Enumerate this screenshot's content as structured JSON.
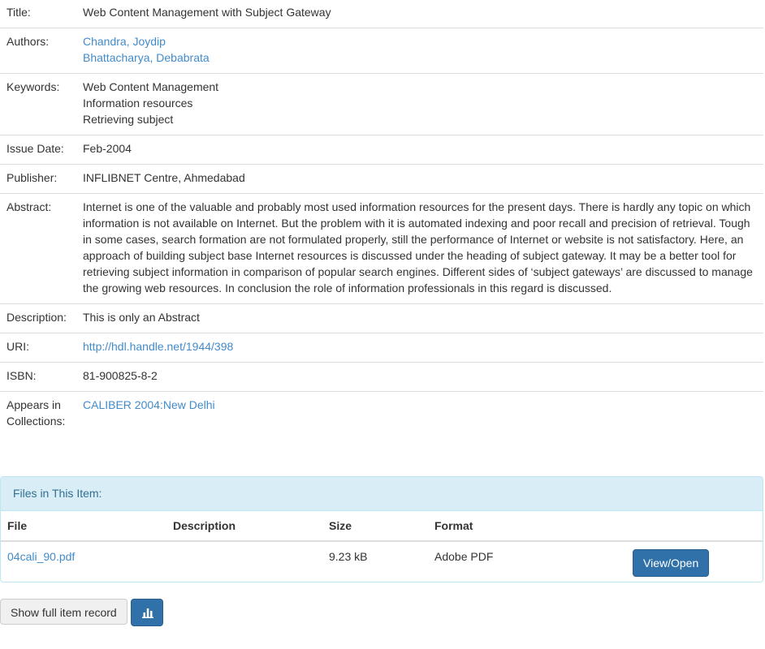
{
  "metadata": {
    "title": {
      "label": "Title:",
      "value": "Web Content Management with Subject Gateway"
    },
    "authors": {
      "label": "Authors:",
      "values": [
        "Chandra, Joydip",
        "Bhattacharya, Debabrata"
      ]
    },
    "keywords": {
      "label": "Keywords:",
      "values": [
        "Web Content Management",
        "Information resources",
        "Retrieving subject"
      ]
    },
    "issue_date": {
      "label": "Issue Date:",
      "value": "Feb-2004"
    },
    "publisher": {
      "label": "Publisher:",
      "value": "INFLIBNET Centre, Ahmedabad"
    },
    "abstract": {
      "label": "Abstract:",
      "value": "Internet is one of the valuable and probably most used information resources for the present days. There is hardly any topic on which information is not available on Internet. But the problem with it is automated indexing and poor recall and precision of retrieval. Tough in some cases, search formation are not formulated properly, still the performance of Internet or website is not satisfactory. Here, an approach of building subject base Internet resources is discussed under the heading of subject gateway. It may be a better tool for retrieving subject information in comparison of popular search engines. Different sides of ‘subject gateways’ are discussed to manage the growing web resources. In conclusion the role of information professionals in this regard is discussed."
    },
    "description": {
      "label": "Description:",
      "value": "This is only an Abstract"
    },
    "uri": {
      "label": "URI:",
      "value": "http://hdl.handle.net/1944/398"
    },
    "isbn": {
      "label": "ISBN:",
      "value": "81-900825-8-2"
    },
    "collections": {
      "label_line1": "Appears in",
      "label_line2": "Collections:",
      "value": "CALIBER 2004:New Delhi"
    }
  },
  "files_panel": {
    "heading": "Files in This Item:",
    "columns": [
      "File",
      "Description",
      "Size",
      "Format"
    ],
    "rows": [
      {
        "file": "04cali_90.pdf",
        "description": "",
        "size": "9.23 kB",
        "format": "Adobe PDF",
        "action_label": "View/Open"
      }
    ]
  },
  "actions": {
    "full_record_label": "Show full item record",
    "stats_icon": "bar-chart-icon"
  },
  "colors": {
    "link": "#428bca",
    "panel_heading_bg": "#d9edf7",
    "panel_heading_text": "#31708f",
    "primary_button": "#3071a9"
  }
}
